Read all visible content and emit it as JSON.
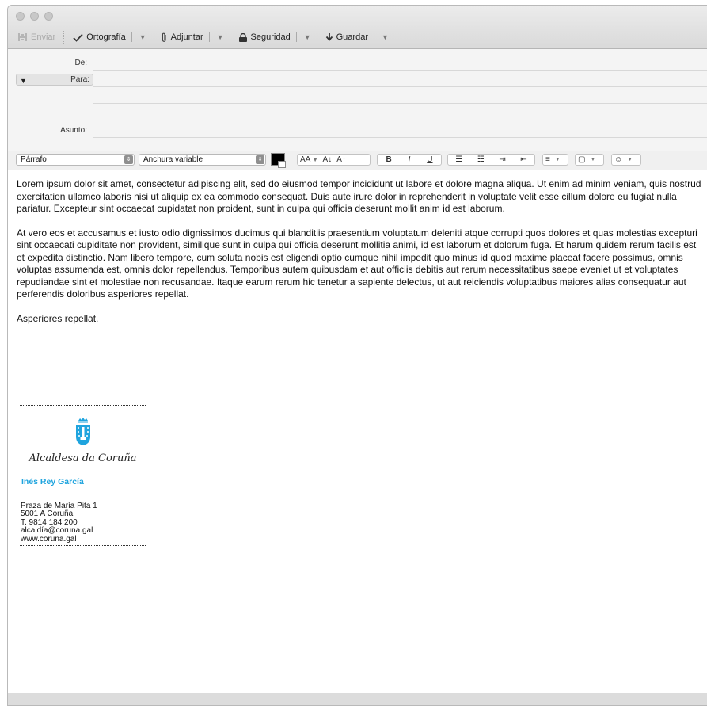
{
  "toolbar": {
    "send_label": "Enviar",
    "spelling_label": "Ortografía",
    "attach_label": "Adjuntar",
    "security_label": "Seguridad",
    "save_label": "Guardar"
  },
  "header": {
    "from_label": "De:",
    "to_label": "Para:",
    "subject_label": "Asunto:",
    "from_value": "",
    "to_value": "",
    "subject_value": ""
  },
  "format": {
    "paragraph_style": "Párrafo",
    "font_name": "Anchura variable",
    "text_color": "#000000",
    "size_label": "AA",
    "shrink_label": "A",
    "grow_label": "A",
    "bold_label": "B",
    "italic_label": "I",
    "underline_label": "U"
  },
  "message": {
    "paragraphs": [
      "Lorem ipsum dolor sit amet, consectetur adipiscing elit, sed do eiusmod tempor incididunt ut labore et dolore magna aliqua. Ut enim ad minim veniam, quis nostrud exercitation ullamco laboris nisi ut aliquip ex ea commodo consequat. Duis aute irure dolor in reprehenderit in voluptate velit esse cillum dolore eu fugiat nulla pariatur. Excepteur sint occaecat cupidatat non proident, sunt in culpa qui officia deserunt mollit anim id est laborum.",
      "At vero eos et accusamus et iusto odio dignissimos ducimus qui blanditiis praesentium voluptatum deleniti atque corrupti quos dolores et quas molestias excepturi sint occaecati cupiditate non provident, similique sunt in culpa qui officia deserunt mollitia animi, id est laborum et dolorum fuga. Et harum quidem rerum facilis est et expedita distinctio. Nam libero tempore, cum soluta nobis est eligendi optio cumque nihil impedit quo minus id quod maxime placeat facere possimus, omnis voluptas assumenda est, omnis dolor repellendus. Temporibus autem quibusdam et aut officiis debitis aut rerum necessitatibus saepe eveniet ut et voluptates repudiandae sint et molestiae non recusandae. Itaque earum rerum hic tenetur a sapiente delectus, ut aut reiciendis voluptatibus maiores alias consequatur aut perferendis doloribus asperiores repellat.",
      "Asperiores repellat."
    ]
  },
  "signature": {
    "office": "Alcaldesa da Coruña",
    "name": "Inés Rey García",
    "name_color": "#1fa4de",
    "address_line": "Praza de María Pita 1",
    "postal_line": "5001 A Coruña",
    "phone_line": "T. 9814 184 200",
    "email_line": "alcaldía@coruna.gal",
    "web_line": "www.coruna.gal"
  }
}
